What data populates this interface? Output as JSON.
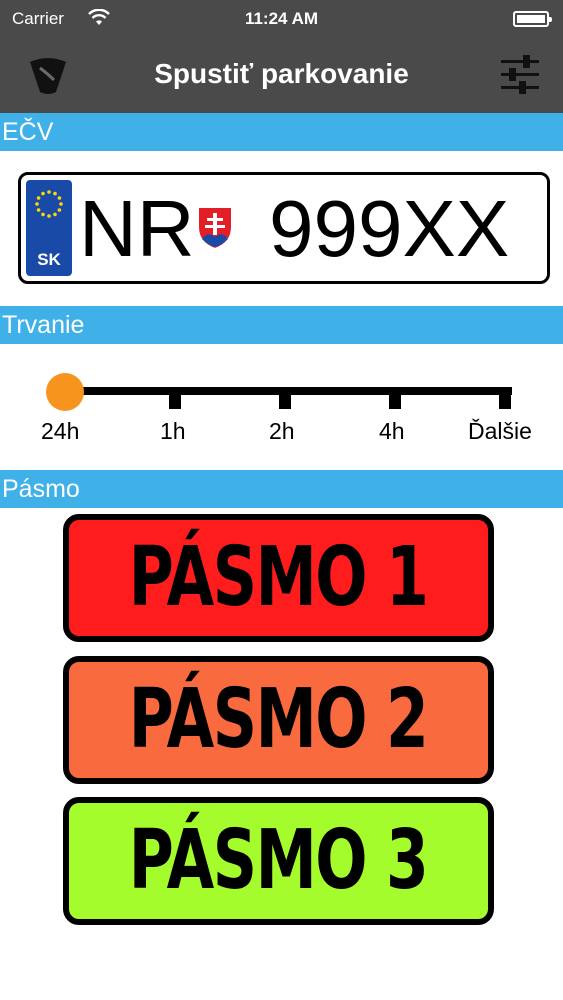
{
  "status_bar": {
    "carrier": "Carrier",
    "time": "11:24 AM",
    "wifi_icon": "wifi-icon",
    "battery_icon": "battery-icon"
  },
  "nav": {
    "title": "Spustiť parkovanie",
    "left_icon": "lock-icon",
    "right_icon": "sliders-icon",
    "background": "#4a4a4a"
  },
  "sections": {
    "plate_header": "EČV",
    "duration_header": "Trvanie",
    "zone_header": "Pásmo",
    "header_color": "#3fb0e8"
  },
  "plate": {
    "country_code": "SK",
    "district": "NR",
    "number": "999XX",
    "coat_of_arms_icon": "slovak-coat-of-arms-icon",
    "eu_stars_icon": "eu-stars-icon"
  },
  "duration": {
    "options": [
      "24h",
      "1h",
      "2h",
      "4h",
      "Ďalšie"
    ],
    "selected": "24h",
    "thumb_color": "#f7941d"
  },
  "zones": [
    {
      "label": "PÁSMO 1",
      "color": "#fe1c1c"
    },
    {
      "label": "PÁSMO 2",
      "color": "#fa6a3f"
    },
    {
      "label": "PÁSMO 3",
      "color": "#a4fc2c"
    }
  ]
}
